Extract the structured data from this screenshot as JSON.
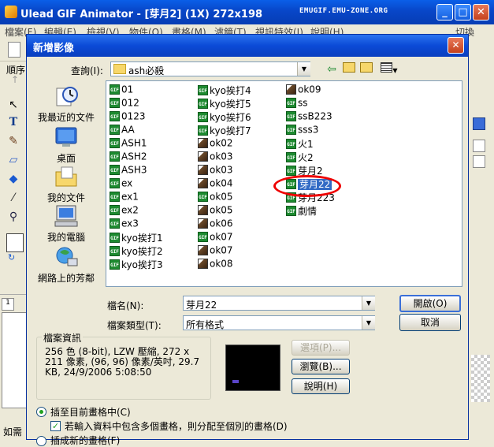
{
  "app": {
    "title": "Ulead GIF Animator - [芽月2] (1X) 272x198",
    "watermark": "EMUGIF.EMU-ZONE.ORG",
    "menu": [
      "檔案(F)",
      "編輯(E)",
      "檢視(V)",
      "物件(O)",
      "畫格(M)",
      "濾鏡(T)",
      "視訊特效(I)",
      "說明(H)"
    ],
    "menu_right": "切換",
    "left_partial": "順序",
    "status_partial": "如需"
  },
  "dialog": {
    "title": "新增影像",
    "close_icon": "close-icon",
    "lookin_label": "查詢(I):",
    "lookin_value": "ash必殺",
    "places": [
      {
        "label": "我最近的文件",
        "icon": "recent-docs-icon"
      },
      {
        "label": "桌面",
        "icon": "desktop-icon"
      },
      {
        "label": "我的文件",
        "icon": "my-documents-icon"
      },
      {
        "label": "我的電腦",
        "icon": "my-computer-icon"
      },
      {
        "label": "網路上的芳鄰",
        "icon": "network-places-icon"
      }
    ],
    "files": {
      "col1": [
        "01",
        "012",
        "0123",
        "AA",
        "ASH1",
        "ASH2",
        "ASH3",
        "ex",
        "ex1",
        "ex2",
        "ex3",
        "kyo挨打1",
        "kyo挨打2",
        "kyo挨打3"
      ],
      "col2": [
        "kyo挨打4",
        "kyo挨打5",
        "kyo挨打6",
        "kyo挨打7",
        "ok02",
        "ok03",
        "ok03",
        "ok04",
        "ok05",
        "ok05",
        "ok06",
        "ok07",
        "ok07",
        "ok08"
      ],
      "col3": [
        "ok09",
        "ss",
        "ssB223",
        "sss3",
        "火1",
        "火2",
        "芽月2",
        "芽月22",
        "芽月223",
        "劇情"
      ],
      "selected": "芽月22"
    },
    "filename_label": "檔名(N):",
    "filename_value": "芽月22",
    "filetype_label": "檔案類型(T):",
    "filetype_value": "所有格式",
    "open_button": "開啟(O)",
    "cancel_button": "取消",
    "info_group_label": "檔案資訊",
    "info_text": "256 色 (8-bit), LZW 壓縮, 272 x 211 像素, (96, 96) 像素/英吋, 29.7 KB, 24/9/2006  5:08:50",
    "options_button": "選項(P)...",
    "browse_button": "瀏覽(B)...",
    "help_button": "說明(H)",
    "insert_radio": "插至目前畫格中(C)",
    "multi_frame_checkbox": "若輸入資料中包含多個畫格，則分配至個別的畫格(D)",
    "new_frame_radio": "插成新的畫格(F)"
  },
  "colors": {
    "titlebar": "#0a5fe8",
    "highlight": "#e00000",
    "selection": "#316ac5"
  }
}
